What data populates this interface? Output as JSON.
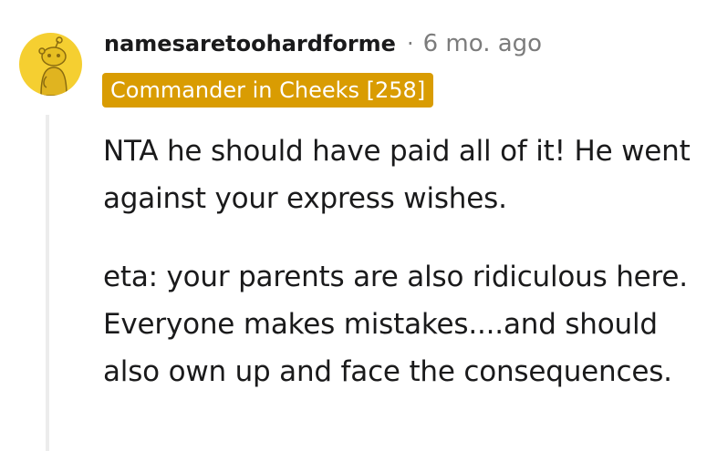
{
  "comment": {
    "author": "namesaretoohardforme",
    "separator": "·",
    "age": "6 mo. ago",
    "flair": "Commander in Cheeks [258]",
    "paragraphs": [
      "NTA he should have paid all of it! He went against your express wishes.",
      "eta: your parents are also ridiculous here. Everyone makes mistakes....and should also own up and face the consequences."
    ]
  },
  "colors": {
    "avatar_bg": "#f5cf31",
    "flair_bg": "#d99c02",
    "meta_gray": "#7c7c7c",
    "thread_line": "#ececec"
  },
  "icons": {
    "avatar": "snoo-avatar-icon"
  }
}
